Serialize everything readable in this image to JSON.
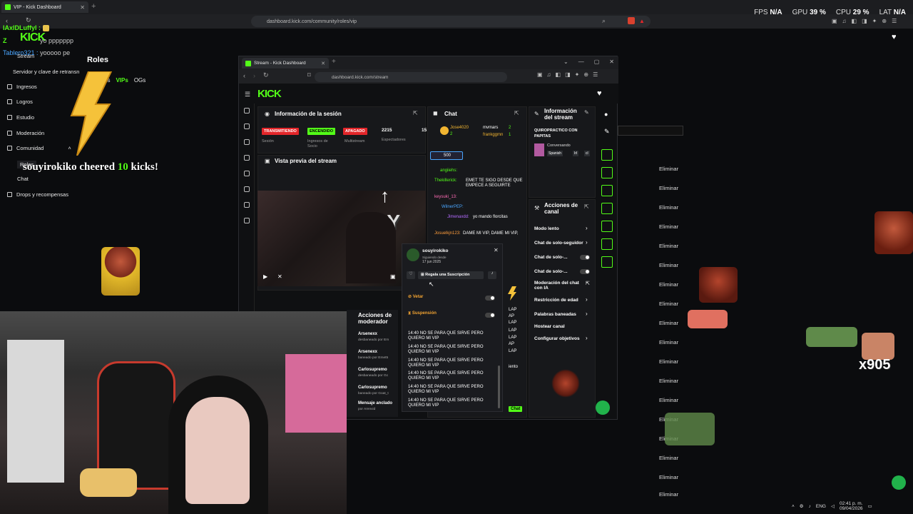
{
  "outer_browser": {
    "tab_title": "VIP - Kick Dashboard",
    "url": "dashboard.kick.com/community/roles/vip"
  },
  "system_stats": {
    "fps_label": "FPS",
    "fps_value": "N/A",
    "gpu_label": "GPU",
    "gpu_value": "39 %",
    "cpu_label": "CPU",
    "cpu_value": "29 %",
    "lat_label": "LAT",
    "lat_value": "N/A"
  },
  "overlay_chat": [
    {
      "user": "lAxlDLuffyl :",
      "text": ""
    },
    {
      "user": "Z",
      "text": "yo ppppppp"
    },
    {
      "user": "Tablero321 :",
      "text": "yooooo pe"
    }
  ],
  "outer_sidebar": {
    "stream_label": "Stream",
    "items": [
      "Servidor y clave de retransn",
      "Ingresos",
      "Logros",
      "Estudio",
      "Moderación",
      "Comunidad",
      "Roles",
      "Chat",
      "Drops y recompensas"
    ]
  },
  "outer_roles": {
    "title": "Roles",
    "tabs": [
      "adores",
      "VIPs",
      "OGs"
    ]
  },
  "cheer_alert": {
    "user": "souyirokiko",
    "mid": " cheered ",
    "amount": "10",
    "suffix": " kicks!"
  },
  "eliminate_label": "Eliminar",
  "inner_browser": {
    "tab_title": "Stream - Kick Dashboard",
    "url": "dashboard.kick.com/stream"
  },
  "session_panel": {
    "title": "Información de la sesión",
    "badges": [
      "TRANSMITIENDO",
      "ENCENDIDO",
      "APAGADO"
    ],
    "viewers": "2215",
    "extra": "15",
    "labels": [
      "Sesión",
      "Ingresos de Socio",
      "Multistream",
      "Espectadores"
    ]
  },
  "preview_panel": {
    "title": "Vista previa del stream",
    "overlay_text": "GAY"
  },
  "chat_panel": {
    "title": "Chat",
    "top_users": [
      {
        "name": "Jose4020",
        "count": "2"
      },
      {
        "name": "mvmars",
        "count": "2"
      },
      {
        "name": "frankggmn",
        "count": "1"
      }
    ],
    "gift_count": "500",
    "messages": [
      {
        "user": "angiiehs:",
        "text": ""
      },
      {
        "user": "Thekillerick:",
        "text": "EMET TE SIGO DESDE QUE EMPECE A SEGUIRTE"
      },
      {
        "user": "keysuki_13:",
        "text": ""
      },
      {
        "user": "WilnerPEP:",
        "text": ""
      },
      {
        "user": "Jimenaxdd:",
        "text": "yo mando florcitas"
      },
      {
        "user": "Josuelkjn123:",
        "text": "DAME MI VIP, DAME MI VIP,"
      }
    ],
    "side_fragments": [
      "LAP",
      "AP",
      "LAP",
      "LAP",
      "LAP",
      "AP",
      "LAP",
      "iento"
    ],
    "send_label": "Chat"
  },
  "user_card": {
    "username": "souyirokiko",
    "following_label": "Siguiendo desde",
    "following_date": "17 jun 2025",
    "gift_sub_label": "Regala una Suscripción",
    "veto_label": "Vetar",
    "suspension_label": "Suspensión",
    "history": [
      {
        "time": "14:40",
        "text": "NO SE PARA QUE SIRVE PERO QUIERO MI VIP"
      },
      {
        "time": "14:40",
        "text": "NO SE PARA QUE SIRVE PERO QUIERO MI VIP"
      },
      {
        "time": "14:40",
        "text": "NO SE PARA QUE SIRVE PERO QUIERO MI VIP"
      },
      {
        "time": "14:40",
        "text": "NO SE PARA QUE SIRVE PERO QUIERO MI VIP"
      },
      {
        "time": "14:40",
        "text": "NO SE PARA QUE SIRVE PERO QUIERO MI VIP"
      },
      {
        "time": "14:40",
        "text": "NO SE PARA QUE SIRVE PERO QUIERO MI VIP"
      }
    ]
  },
  "stream_info_panel": {
    "title": "Información del stream",
    "stream_title": "QUIROPRACTICO CON PAPITAS",
    "category": "Conversando",
    "tags": [
      "Spanish",
      "Irl",
      "cl"
    ]
  },
  "channel_actions": {
    "title": "Acciones de canal",
    "items": [
      "Modo lento",
      "Chat de solo-seguidor",
      "Chat de solo-...",
      "Chat de solo-...",
      "Moderación del chat con IA",
      "Restricción de edad",
      "Palabras baneadas",
      "Hostear canal",
      "Configurar objetivos"
    ]
  },
  "mod_actions": {
    "title": "Acciones de moderador",
    "entries": [
      {
        "name": "Arsenexx",
        "sub": "desbaneado por Em"
      },
      {
        "name": "Arsenexx",
        "sub": "baneado por Emet5"
      },
      {
        "name": "Carlosupremo",
        "sub": "desbaneado por Gc"
      },
      {
        "name": "Carlosupremo",
        "sub": "baneado por Goat_t"
      },
      {
        "name": "Mensaje anclado",
        "sub": "por Arenvid"
      }
    ]
  },
  "alert_count": "x905",
  "taskbar": {
    "lang": "ENG",
    "time": "02:41 p. m.",
    "date": "09/04/2026"
  },
  "colors": {
    "kick_green": "#53fc18",
    "live_red": "#e3262a",
    "bg": "#0b0c0e"
  }
}
